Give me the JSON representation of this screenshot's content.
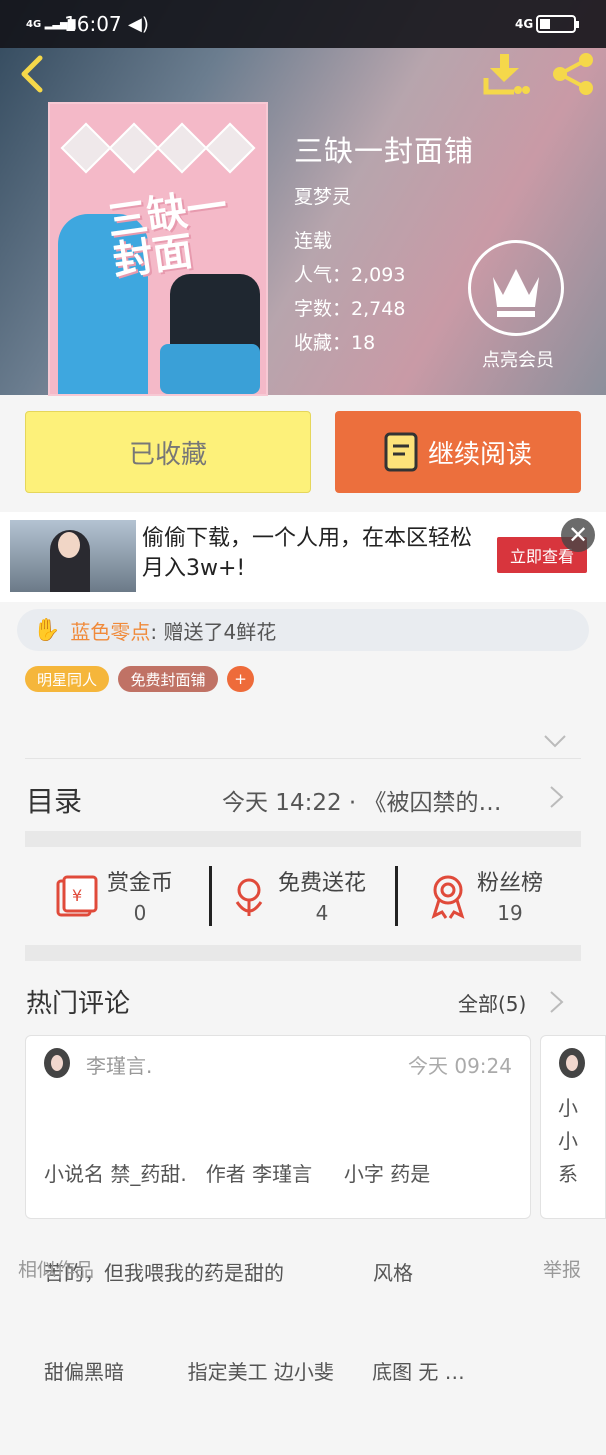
{
  "status_bar": {
    "network": "4G",
    "time": "16:07",
    "network_right": "4G"
  },
  "book": {
    "title": "三缺一封面铺",
    "author": "夏梦灵",
    "state": "连载",
    "popularity_label": "人气",
    "popularity": "2,093",
    "words_label": "字数",
    "words": "2,748",
    "collected_label": "收藏",
    "collected": "18",
    "cover_art_title": "三缺一\n封面"
  },
  "member": {
    "label": "点亮会员"
  },
  "buttons": {
    "collected": "已收藏",
    "continue_reading": "继续阅读"
  },
  "ad": {
    "text": "偷偷下载，一个人用，在本区轻松月入3w+!",
    "cta": "立即查看"
  },
  "gift": {
    "user": "蓝色零点",
    "message": ": 赠送了4鲜花"
  },
  "tags": [
    {
      "label": "明星同人",
      "color": "#f5b63b"
    },
    {
      "label": "免费封面铺",
      "color": "#c07265"
    },
    {
      "label": "+",
      "color": "#ee6b3a"
    }
  ],
  "catalog": {
    "title": "目录",
    "latest": "今天 14:22 · 《被囚禁的…"
  },
  "stats": [
    {
      "name": "赏金币",
      "value": "0"
    },
    {
      "name": "免费送花",
      "value": "4"
    },
    {
      "name": "粉丝榜",
      "value": "19"
    }
  ],
  "comments": {
    "title": "热门评论",
    "all_label": "全部(5)",
    "items": [
      {
        "user": "李瑾言.",
        "time": "今天 09:24",
        "line1": "小说名 禁_药甜.   作者 李瑾言     小字 药是",
        "line2": "苦的，但我喂我的药是甜的              风格",
        "line3": "甜偏黑暗          指定美工 边小斐      底图 无 …"
      }
    ],
    "peek_lines": [
      "小",
      "小",
      "系"
    ]
  },
  "footer": {
    "similar": "相似作品",
    "report": "举报"
  },
  "colors": {
    "accent_orange": "#ec6f3d",
    "accent_yellow": "#fdf17a",
    "icon_red": "#e04a3a"
  }
}
